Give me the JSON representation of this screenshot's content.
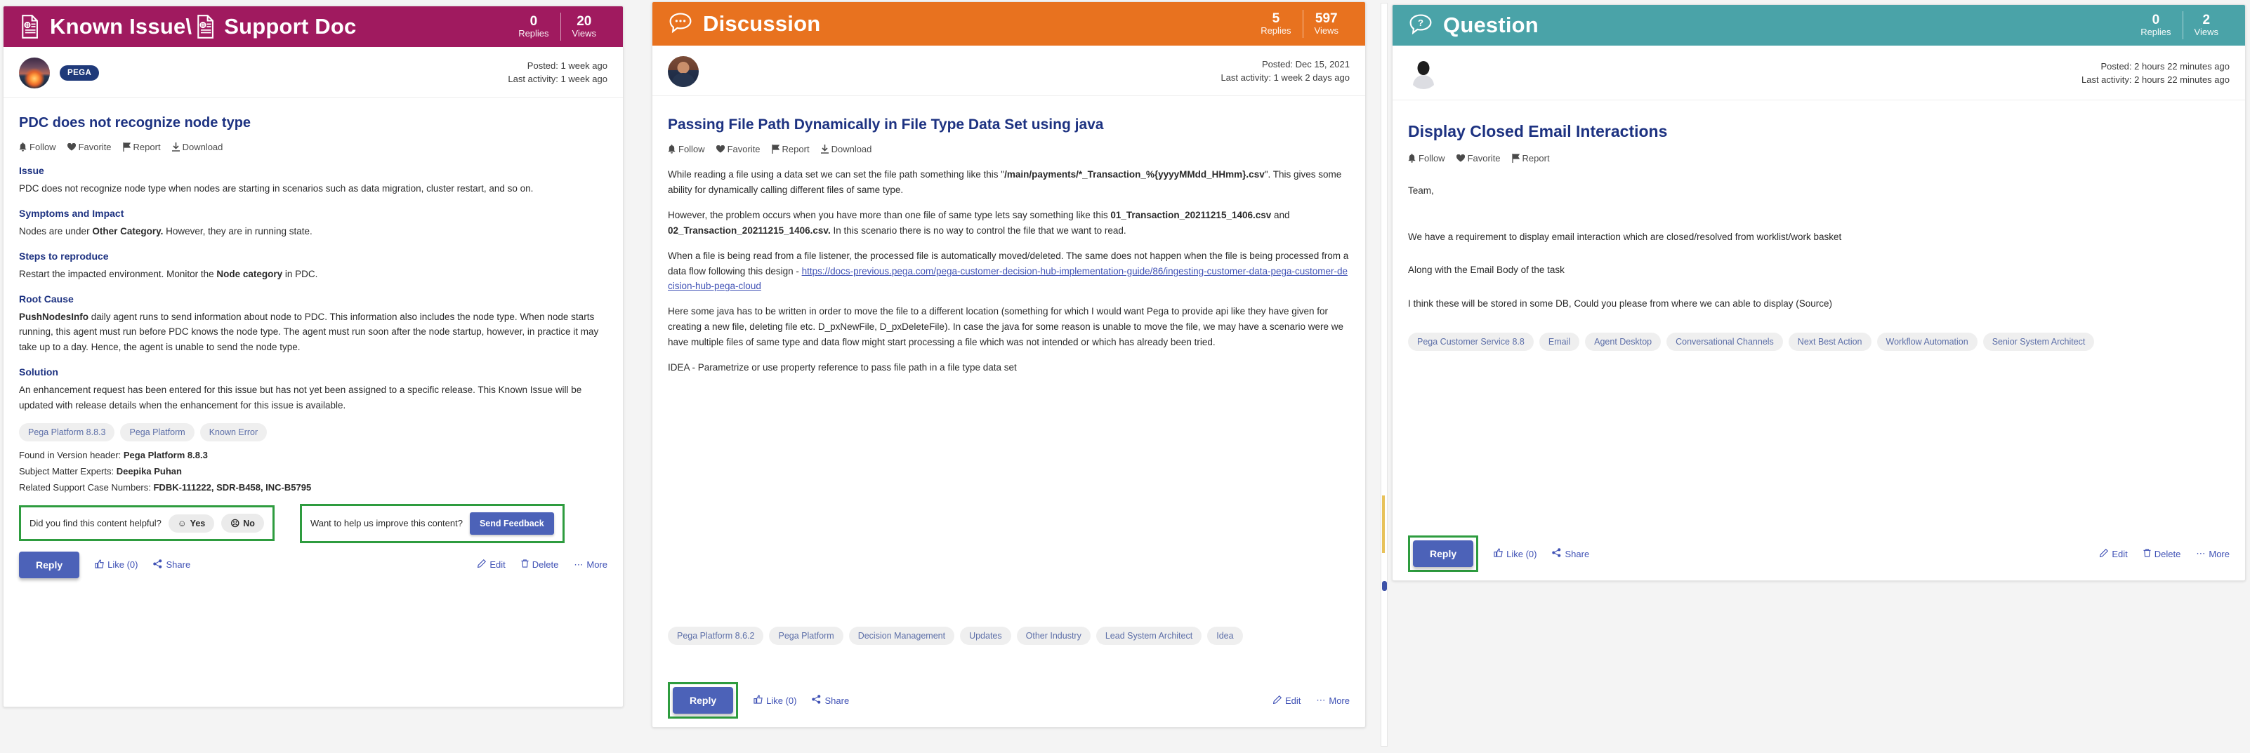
{
  "theme": {
    "known_issue_header_bg": "#a01a5f",
    "discussion_header_bg": "#e8721f",
    "question_header_bg": "#4aa3a8",
    "title_blue": "#1d3281",
    "link_blue": "#3f51b5",
    "button_blue": "#4c62b8",
    "highlight_green": "#2e9c3f",
    "tag_bg": "#efefef",
    "tag_text": "#5d6fa8"
  },
  "panels": [
    {
      "id": "known-issue",
      "header": {
        "title_primary": "Known Issue\\",
        "title_secondary": "Support Doc",
        "icon": "document-icon",
        "stats": [
          {
            "num": "0",
            "label": "Replies"
          },
          {
            "num": "20",
            "label": "Views"
          }
        ]
      },
      "author": {
        "avatar": "sunset-avatar",
        "badge": "PEGA",
        "posted": "Posted: 1 week ago",
        "last_activity": "Last activity: 1 week ago"
      },
      "post_title": "PDC does not recognize node type",
      "meta_actions": [
        {
          "icon": "bell-icon",
          "label": "Follow"
        },
        {
          "icon": "heart-icon",
          "label": "Favorite"
        },
        {
          "icon": "flag-icon",
          "label": "Report"
        },
        {
          "icon": "download-icon",
          "label": "Download"
        }
      ],
      "sections": [
        {
          "heading": "Issue",
          "body": "PDC does not recognize node type when nodes are starting in scenarios such as data migration, cluster restart, and so on."
        },
        {
          "heading": "Symptoms and Impact",
          "body_pre": "Nodes are under ",
          "body_bold": "Other Category.",
          "body_post": " However, they are in running state."
        },
        {
          "heading": "Steps to reproduce",
          "body_pre": "Restart the impacted environment. Monitor the ",
          "body_bold": "Node category",
          "body_post": " in PDC."
        },
        {
          "heading": "Root Cause",
          "body_bold": "PushNodesInfo",
          "body_post": " daily agent runs to send information about node to PDC. This information also includes the node type. When node starts running, this agent must run before PDC knows the node type. The agent must run soon after the node startup, however, in practice it may take up to a day. Hence, the agent is unable to send the node type."
        },
        {
          "heading": "Solution",
          "body": "An enhancement request has been entered for this issue but has not yet been assigned to a specific release. This Known Issue will be updated with release details when the enhancement for this issue is available."
        }
      ],
      "tags": [
        "Pega Platform 8.8.3",
        "Pega Platform",
        "Known Error"
      ],
      "kv": [
        {
          "key": "Found in Version header: ",
          "value": "Pega Platform 8.8.3"
        },
        {
          "key": "Subject Matter Experts: ",
          "value": "Deepika Puhan"
        },
        {
          "key": "Related Support Case Numbers: ",
          "value": "FDBK-111222, SDR-B458, INC-B5795"
        }
      ],
      "feedback": {
        "helpful_question": "Did you find this content helpful?",
        "yes_label": "Yes",
        "no_label": "No",
        "improve_question": "Want to help us improve this content?",
        "send_label": "Send Feedback"
      },
      "actions": {
        "reply": "Reply",
        "like": "Like (0)",
        "share": "Share",
        "edit": "Edit",
        "delete": "Delete",
        "more": "More"
      }
    },
    {
      "id": "discussion",
      "header": {
        "title_primary": "Discussion",
        "icon": "speech-bubble-icon",
        "stats": [
          {
            "num": "5",
            "label": "Replies"
          },
          {
            "num": "597",
            "label": "Views"
          }
        ]
      },
      "author": {
        "avatar": "person-avatar",
        "posted": "Posted: Dec 15, 2021",
        "last_activity": "Last activity: 1 week 2 days ago"
      },
      "post_title": "Passing File Path Dynamically in File Type Data Set using java",
      "meta_actions": [
        {
          "icon": "bell-icon",
          "label": "Follow"
        },
        {
          "icon": "heart-icon",
          "label": "Favorite"
        },
        {
          "icon": "flag-icon",
          "label": "Report"
        },
        {
          "icon": "download-icon",
          "label": "Download"
        }
      ],
      "paragraphs": [
        {
          "pre": "While reading a file using a data set we can set the file path something like this \"",
          "bold": "/main/payments/*_Transaction_%{yyyyMMdd_HHmm}.csv",
          "post": "\". This gives some ability for dynamically calling different files of same type."
        },
        {
          "pre": "However, the problem occurs when you have more than one file of same type lets say something like this ",
          "bold": "01_Transaction_20211215_1406.csv",
          "mid": " and ",
          "bold2": "02_Transaction_20211215_1406.csv.",
          "post": " In this scenario there is no way to control the file that we want to read."
        },
        {
          "pre": "When a file is being read from a file listener, the processed file is automatically moved/deleted. The same does not happen when the file is being processed from a data flow following this design - ",
          "link": "https://docs-previous.pega.com/pega-customer-decision-hub-implementation-guide/86/ingesting-customer-data-pega-customer-decision-hub-pega-cloud"
        },
        {
          "pre": "Here some java has to be written in order to move the file to a different location (something for which I would want Pega to provide api like they have given for creating a  new file, deleting file etc. D_pxNewFile, D_pxDeleteFile). In case the java for some reason is unable to move the file, we may have a scenario were we have multiple files of same type and data flow might start processing a file which was not intended or which has already been tried."
        },
        {
          "pre": "IDEA - Parametrize or use property reference to pass file path in a file type data set"
        }
      ],
      "tags": [
        "Pega Platform 8.6.2",
        "Pega Platform",
        "Decision Management",
        "Updates",
        "Other Industry",
        "Lead System Architect",
        "Idea"
      ],
      "actions": {
        "reply": "Reply",
        "like": "Like (0)",
        "share": "Share",
        "edit": "Edit",
        "more": "More"
      }
    },
    {
      "id": "question",
      "header": {
        "title_primary": "Question",
        "icon": "question-bubble-icon",
        "stats": [
          {
            "num": "0",
            "label": "Replies"
          },
          {
            "num": "2",
            "label": "Views"
          }
        ]
      },
      "author": {
        "avatar": "anonymous-avatar",
        "posted": "Posted: 2 hours 22 minutes ago",
        "last_activity": "Last activity: 2 hours 22 minutes ago"
      },
      "post_title": "Display Closed Email Interactions",
      "meta_actions": [
        {
          "icon": "bell-icon",
          "label": "Follow"
        },
        {
          "icon": "heart-icon",
          "label": "Favorite"
        },
        {
          "icon": "flag-icon",
          "label": "Report"
        }
      ],
      "paragraphs": [
        "Team,",
        "We have a requirement to display email interaction which are closed/resolved from worklist/work basket",
        "Along with the Email Body of the task",
        "I think these will be stored in some DB, Could you please from where we can able to display (Source)"
      ],
      "tags": [
        "Pega Customer Service 8.8",
        "Email",
        "Agent Desktop",
        "Conversational Channels",
        "Next Best Action",
        "Workflow Automation",
        "Senior System Architect"
      ],
      "actions": {
        "reply": "Reply",
        "like": "Like (0)",
        "share": "Share",
        "edit": "Edit",
        "delete": "Delete",
        "more": "More"
      }
    }
  ]
}
